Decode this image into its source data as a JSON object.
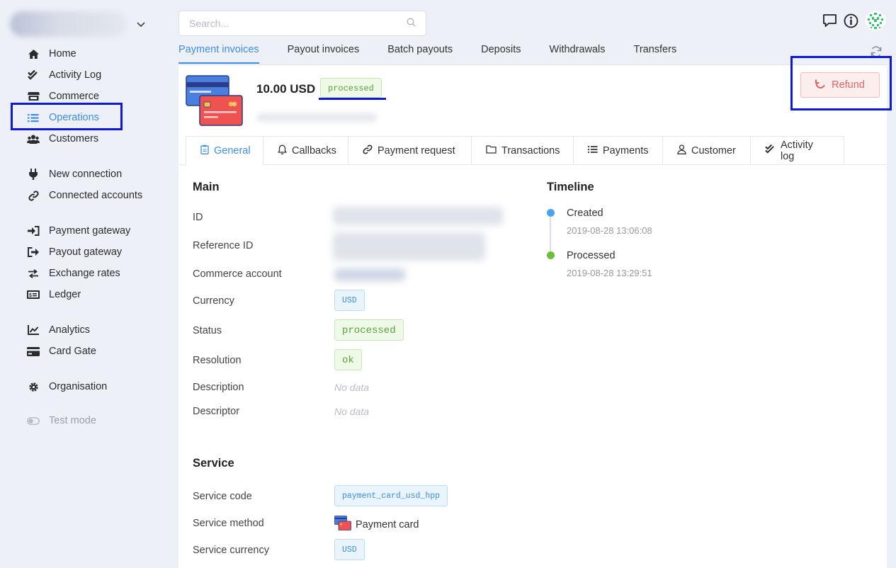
{
  "sidebar": {
    "items": [
      {
        "label": "Home",
        "icon": "home-icon"
      },
      {
        "label": "Activity Log",
        "icon": "check-double-icon"
      },
      {
        "label": "Commerce",
        "icon": "store-icon"
      },
      {
        "label": "Operations",
        "icon": "list-icon"
      },
      {
        "label": "Customers",
        "icon": "users-icon"
      },
      {
        "label": "New connection",
        "icon": "plug-icon"
      },
      {
        "label": "Connected accounts",
        "icon": "link-icon"
      },
      {
        "label": "Payment gateway",
        "icon": "sign-in-icon"
      },
      {
        "label": "Payout gateway",
        "icon": "sign-out-icon"
      },
      {
        "label": "Exchange rates",
        "icon": "exchange-icon"
      },
      {
        "label": "Ledger",
        "icon": "money-bill-icon"
      },
      {
        "label": "Analytics",
        "icon": "chart-line-icon"
      },
      {
        "label": "Card Gate",
        "icon": "credit-card-icon"
      },
      {
        "label": "Organisation",
        "icon": "gear-icon"
      },
      {
        "label": "Test mode",
        "icon": "toggle-icon"
      }
    ],
    "active": "Operations"
  },
  "search": {
    "placeholder": "Search..."
  },
  "top_tabs": [
    "Payment invoices",
    "Payout invoices",
    "Batch payouts",
    "Deposits",
    "Withdrawals",
    "Transfers"
  ],
  "header": {
    "amount": "10.00 USD",
    "status": "processed",
    "refund_label": "Refund"
  },
  "inner_tabs": [
    {
      "label": "General",
      "icon": "clipboard-icon"
    },
    {
      "label": "Callbacks",
      "icon": "bell-icon"
    },
    {
      "label": "Payment request",
      "icon": "link-icon"
    },
    {
      "label": "Transactions",
      "icon": "folder-icon"
    },
    {
      "label": "Payments",
      "icon": "list-icon"
    },
    {
      "label": "Customer",
      "icon": "user-icon"
    },
    {
      "label": "Activity log",
      "icon": "check-double-icon"
    }
  ],
  "main": {
    "title": "Main",
    "labels": {
      "id": "ID",
      "reference_id": "Reference ID",
      "commerce_account": "Commerce account",
      "currency": "Currency",
      "status": "Status",
      "resolution": "Resolution",
      "description": "Description",
      "descriptor": "Descriptor"
    },
    "values": {
      "currency": "USD",
      "status": "processed",
      "resolution": "ok",
      "description": "No data",
      "descriptor": "No data"
    }
  },
  "timeline": {
    "title": "Timeline",
    "events": [
      {
        "title": "Created",
        "time": "2019-08-28 13:06:08",
        "color": "#4aa3f0"
      },
      {
        "title": "Processed",
        "time": "2019-08-28 13:29:51",
        "color": "#6bbf3b"
      }
    ]
  },
  "service": {
    "title": "Service",
    "labels": {
      "code": "Service code",
      "method": "Service method",
      "currency": "Service currency"
    },
    "values": {
      "code": "payment_card_usd_hpp",
      "method": "Payment card",
      "currency": "USD"
    }
  },
  "colors": {
    "accent": "#3d8ee6",
    "highlight": "#0e19d8",
    "refund": "#e46262",
    "success": "#5aa33a"
  }
}
